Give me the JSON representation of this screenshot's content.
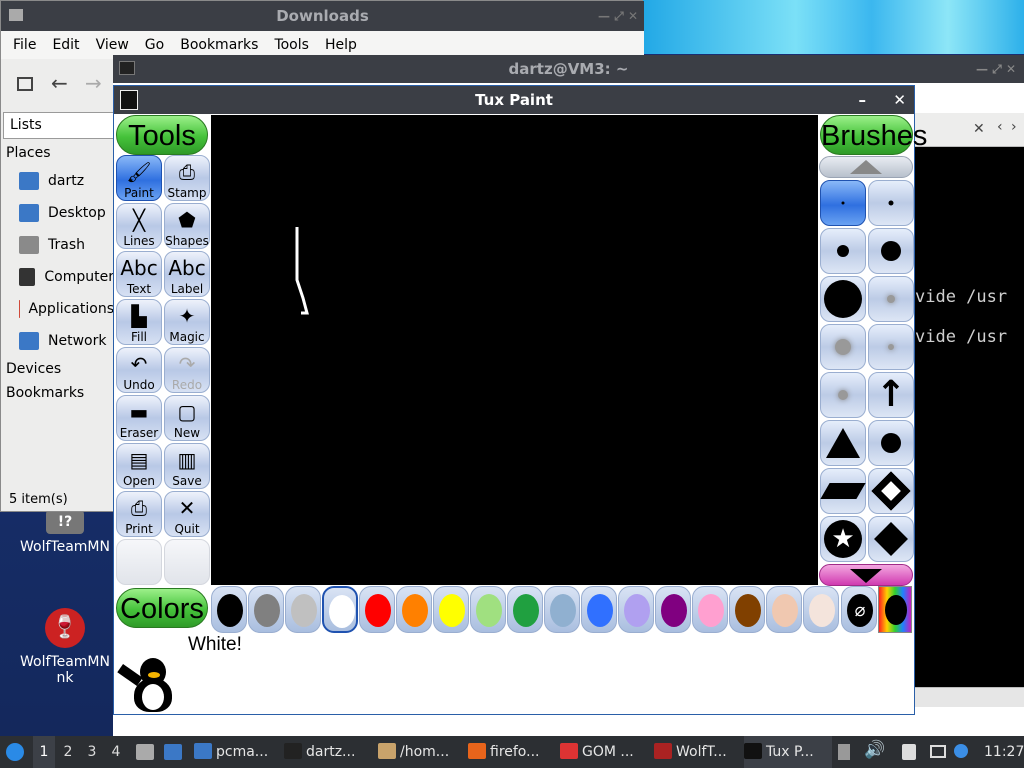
{
  "file_manager": {
    "title": "Downloads",
    "menu": [
      "File",
      "Edit",
      "View",
      "Go",
      "Bookmarks",
      "Tools",
      "Help"
    ],
    "location_mode": "Lists",
    "places_header": "Places",
    "places": [
      {
        "label": "dartz",
        "icon": "home-folder-icon",
        "color": "#3b78c6"
      },
      {
        "label": "Desktop",
        "icon": "desktop-icon",
        "color": "#3b78c6"
      },
      {
        "label": "Trash",
        "icon": "trash-icon",
        "color": "#8a8a8a"
      },
      {
        "label": "Computer",
        "icon": "computer-icon",
        "color": "#333"
      },
      {
        "label": "Applications",
        "icon": "applications-icon",
        "color": "#d04a3a"
      },
      {
        "label": "Network",
        "icon": "network-icon",
        "color": "#3b78c6"
      }
    ],
    "devices_header": "Devices",
    "bookmarks_header": "Bookmarks",
    "status": "5 item(s)"
  },
  "terminal": {
    "title": "dartz@VM3: ~",
    "lines": [
      "vide /usr",
      "vide /usr"
    ]
  },
  "tuxpaint": {
    "title": "Tux Paint",
    "tools_label": "Tools",
    "brushes_label": "Brushes",
    "colors_label": "Colors",
    "tools": [
      {
        "label": "Paint",
        "glyph": "🖌",
        "selected": true
      },
      {
        "label": "Stamp",
        "glyph": "⎙"
      },
      {
        "label": "Lines",
        "glyph": "╳"
      },
      {
        "label": "Shapes",
        "glyph": "⬟"
      },
      {
        "label": "Text",
        "glyph": "Abc"
      },
      {
        "label": "Label",
        "glyph": "Abc"
      },
      {
        "label": "Fill",
        "glyph": "▙"
      },
      {
        "label": "Magic",
        "glyph": "✦"
      },
      {
        "label": "Undo",
        "glyph": "↶"
      },
      {
        "label": "Redo",
        "glyph": "↷",
        "disabled": true
      },
      {
        "label": "Eraser",
        "glyph": "▬"
      },
      {
        "label": "New",
        "glyph": "▢"
      },
      {
        "label": "Open",
        "glyph": "▤"
      },
      {
        "label": "Save",
        "glyph": "▥"
      },
      {
        "label": "Print",
        "glyph": "⎙"
      },
      {
        "label": "Quit",
        "glyph": "✕"
      }
    ],
    "color_status": "White!",
    "colors": [
      "#000000",
      "#808080",
      "#c0c0c0",
      "#ffffff",
      "#ff0000",
      "#ff8000",
      "#ffff00",
      "#a0e080",
      "#20a040",
      "#90b0d0",
      "#3070ff",
      "#b0a0f0",
      "#800080",
      "#ffa0d0",
      "#804000",
      "#f0c8b0",
      "#f4e4dc"
    ],
    "selected_color_index": 3
  },
  "desktop_icons": [
    {
      "label": "WolfTeamMN"
    },
    {
      "label": "WolfTeamMN\nnk"
    }
  ],
  "taskbar": {
    "workspaces": [
      "1",
      "2",
      "3",
      "4"
    ],
    "tasks": [
      {
        "label": "pcma...",
        "icon": "folder-icon"
      },
      {
        "label": "dartz...",
        "icon": "terminal-icon"
      },
      {
        "label": "/hom...",
        "icon": "archive-icon"
      },
      {
        "label": "firefo...",
        "icon": "firefox-icon"
      },
      {
        "label": "GOM ...",
        "icon": "gom-icon"
      },
      {
        "label": "WolfT...",
        "icon": "wine-icon"
      },
      {
        "label": "Tux P...",
        "icon": "tuxpaint-icon"
      }
    ],
    "clock": "11:27"
  }
}
